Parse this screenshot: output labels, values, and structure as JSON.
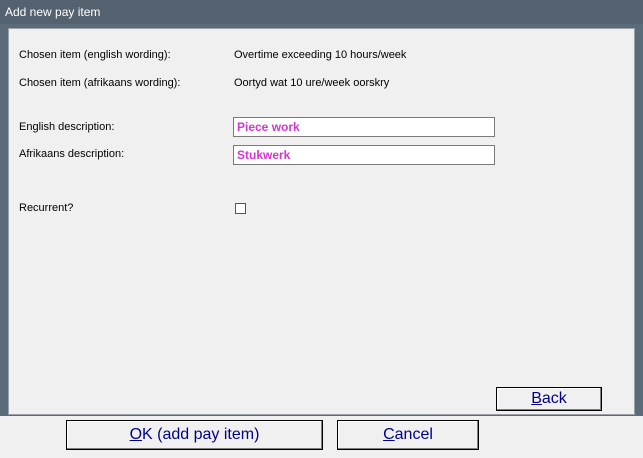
{
  "window": {
    "title": "Add new pay item"
  },
  "form": {
    "chosen_english_label": "Chosen item (english wording):",
    "chosen_english_value": "Overtime exceeding 10 hours/week",
    "chosen_afrikaans_label": "Chosen item (afrikaans wording):",
    "chosen_afrikaans_value": "Oortyd wat 10 ure/week oorskry",
    "english_desc_label": "English description:",
    "english_desc_value": "Piece work",
    "afrikaans_desc_label": "Afrikaans description:",
    "afrikaans_desc_value": "Stukwerk",
    "recurrent_label": "Recurrent?",
    "recurrent_checked": false
  },
  "buttons": {
    "back": {
      "mnemonic": "B",
      "rest": "ack"
    },
    "ok": {
      "mnemonic": "O",
      "rest": "K (add pay item)"
    },
    "cancel": {
      "mnemonic": "C",
      "rest": "ancel"
    }
  },
  "colors": {
    "title_bg": "#54626f",
    "field_text": "#d633d6",
    "button_text": "#00008b"
  }
}
